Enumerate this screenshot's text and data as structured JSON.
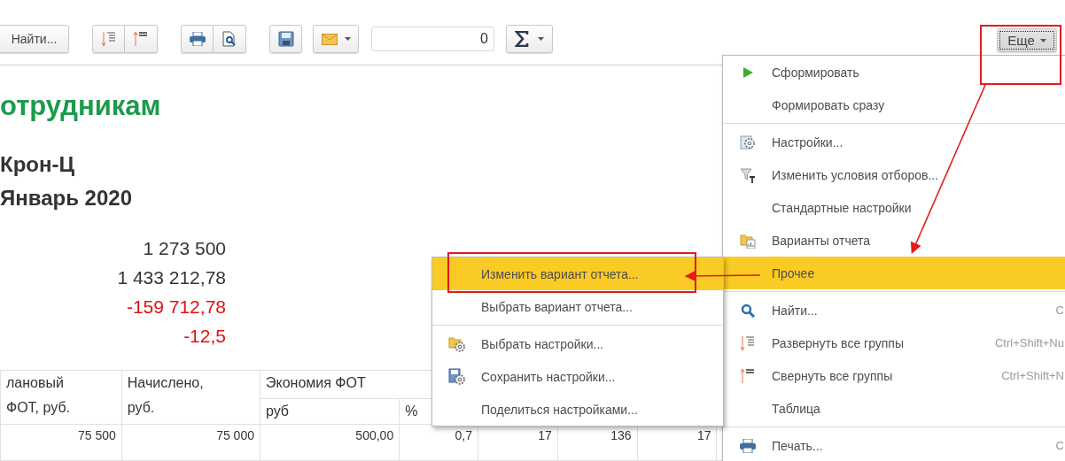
{
  "toolbar": {
    "find_button": "Найти...",
    "counter_value": "0",
    "more_button": {
      "label": "Еще",
      "selected": true
    }
  },
  "report": {
    "title": "отрудникам",
    "organization": "Крон-Ц",
    "period": "Январь 2020",
    "totals": [
      {
        "value": "1 273 500",
        "color": "#333333"
      },
      {
        "value": "1 433 212,78",
        "color": "#333333"
      },
      {
        "value": "-159 712,78",
        "color": "#e01010"
      },
      {
        "value": "-12,5",
        "color": "#e01010"
      }
    ]
  },
  "table": {
    "columns": [
      "лановый ФОТ, руб.",
      "Начислено, руб."
    ],
    "column_groups": [
      {
        "label": "Экономия ФОТ",
        "columns": [
          "руб",
          "%"
        ]
      }
    ],
    "rows": [
      [
        "75 500",
        "75 000",
        "500,00",
        "0,7",
        "17",
        "136",
        "17"
      ]
    ]
  },
  "menu": {
    "groups": [
      [
        {
          "label": "Сформировать",
          "selected": false
        },
        {
          "label": "Формировать сразу",
          "selected": false
        }
      ],
      [
        {
          "label": "Настройки...",
          "selected": false
        },
        {
          "label": "Изменить условия отборов...",
          "selected": false
        },
        {
          "label": "Стандартные настройки",
          "selected": false
        },
        {
          "label": "Варианты отчета",
          "selected": false
        },
        {
          "label": "Прочее",
          "selected": true
        }
      ],
      [
        {
          "label": "Найти...",
          "shortcut": "C",
          "selected": false
        },
        {
          "label": "Развернуть все группы",
          "shortcut": "Ctrl+Shift+Nu",
          "selected": false
        },
        {
          "label": "Свернуть все группы",
          "shortcut": "Ctrl+Shift+N",
          "selected": false
        },
        {
          "label": "Таблица",
          "selected": false
        }
      ],
      [
        {
          "label": "Печать...",
          "shortcut": "C",
          "selected": false
        }
      ]
    ]
  },
  "submenu": {
    "groups": [
      [
        {
          "label": "Изменить вариант отчета...",
          "selected": true
        },
        {
          "label": "Выбрать вариант отчета...",
          "selected": false
        }
      ],
      [
        {
          "label": "Выбрать настройки...",
          "selected": false
        },
        {
          "label": "Сохранить настройки...",
          "selected": false
        },
        {
          "label": "Поделиться настройками...",
          "selected": false
        }
      ]
    ]
  }
}
